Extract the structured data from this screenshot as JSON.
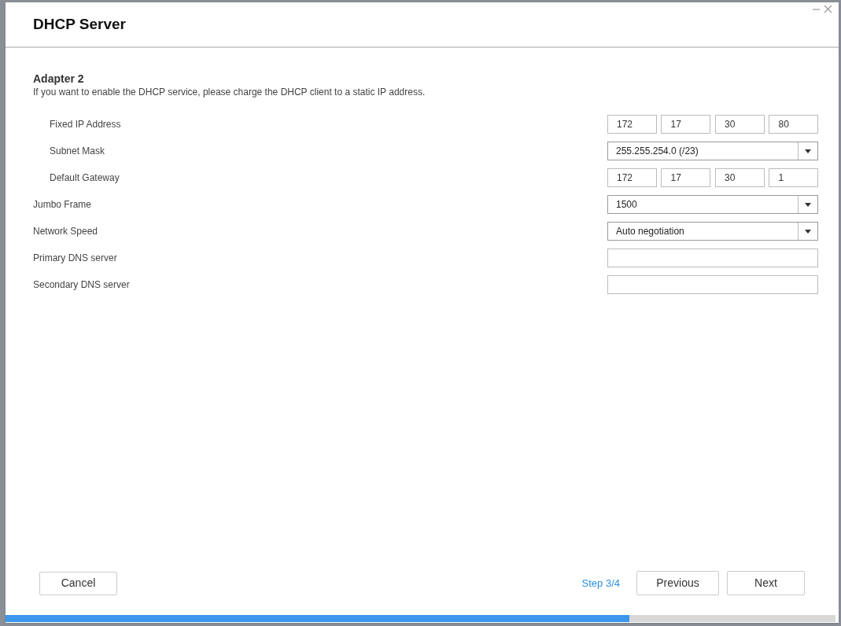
{
  "dialog": {
    "title": "DHCP Server"
  },
  "section": {
    "heading": "Adapter 2",
    "note": "If you want to enable the DHCP service, please charge the DHCP client to a static IP address."
  },
  "ip_settings": [
    {
      "kind": "ip",
      "label": "Fixed IP Address",
      "octets": [
        "172",
        "17",
        "30",
        "80"
      ]
    },
    {
      "kind": "select",
      "label": "Subnet Mask",
      "value": "255.255.254.0 (/23)"
    },
    {
      "kind": "ip",
      "label": "Default Gateway",
      "octets": [
        "172",
        "17",
        "30",
        "1"
      ]
    }
  ],
  "fields": [
    {
      "kind": "select",
      "label": "Jumbo Frame",
      "value": "1500"
    },
    {
      "kind": "select",
      "label": "Network Speed",
      "value": "Auto negotiation"
    },
    {
      "kind": "text",
      "label": "Primary DNS server"
    },
    {
      "kind": "text",
      "label": "Secondary DNS server"
    }
  ],
  "footer": {
    "cancel": "Cancel",
    "step": "Step 3/4",
    "previous": "Previous",
    "next": "Next"
  },
  "progress": {
    "level": 0.752
  }
}
